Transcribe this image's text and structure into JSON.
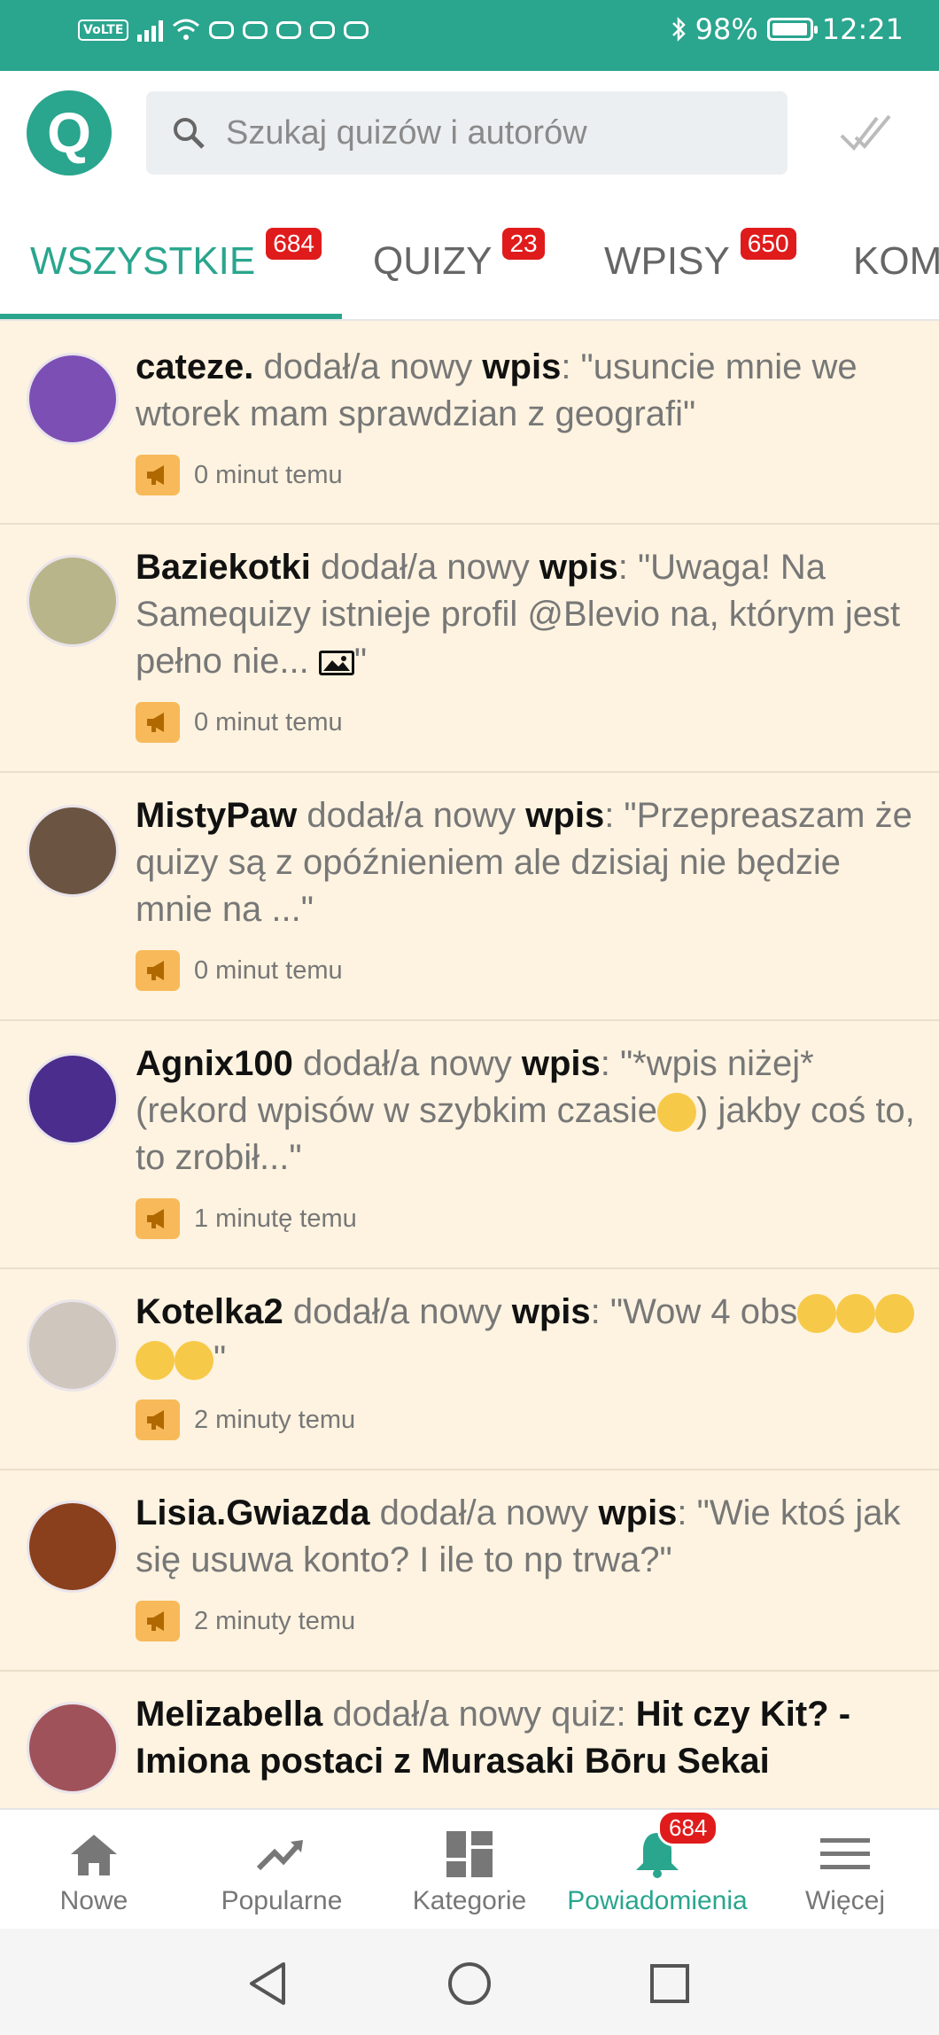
{
  "status_bar": {
    "volte": "VoLTE",
    "battery_pct": "98%",
    "battery_level": 0.98,
    "time": "12:21"
  },
  "header": {
    "logo_letter": "Q",
    "search_placeholder": "Szukaj quizów i autorów"
  },
  "tabs": [
    {
      "label": "WSZYSTKIE",
      "badge": "684",
      "active": true
    },
    {
      "label": "QUIZY",
      "badge": "23"
    },
    {
      "label": "WPISY",
      "badge": "650"
    },
    {
      "label": "KOM"
    }
  ],
  "feed": [
    {
      "user": "cateze.",
      "action": "dodał/a nowy",
      "type": "wpis",
      "text": "\"usuncie mnie we wtorek mam sprawdzian z geografi\"",
      "time": "0 minut temu",
      "avatar": "#7c4fb5"
    },
    {
      "user": "Baziekotki",
      "action": "dodał/a nowy",
      "type": "wpis",
      "text_before": "\"Uwaga! Na Samequizy istnieje profil @Blevio na, którym jest pełno nie...",
      "text_after": "\"",
      "time": "0 minut temu",
      "avatar": "#b9b58a"
    },
    {
      "user": "MistyPaw",
      "action": "dodał/a nowy",
      "type": "wpis",
      "text": "\"Przepreaszam że quizy są z opóźnieniem ale dzisiaj nie będzie mnie na ...\"",
      "time": "0 minut temu",
      "avatar": "#6b5442"
    },
    {
      "user": "Agnix100",
      "action": "dodał/a nowy",
      "type": "wpis",
      "text_before": "\"*wpis niżej* (rekord wpisów w szybkim czasie",
      "text_after": ") jakby coś to, to zrobił...\"",
      "time": "1 minutę temu",
      "avatar": "#4a2d8c"
    },
    {
      "user": "Kotelka2",
      "action": "dodał/a nowy",
      "type": "wpis",
      "text_before": "\"Wow 4 obs",
      "text_after": "\"",
      "time": "2 minuty temu",
      "avatar": "#cfc7bd"
    },
    {
      "user": "Lisia.Gwiazda",
      "action": "dodał/a nowy",
      "type": "wpis",
      "text": "\"Wie ktoś jak się usuwa konto? I ile to np trwa?\"",
      "time": "2 minuty temu",
      "avatar": "#8a3f1d"
    },
    {
      "user": "Melizabella",
      "action": "dodał/a nowy quiz:",
      "quiz_title": "Hit czy Kit? - Imiona postaci z Murasaki Bōru Sekai",
      "avatar": "#a0525a"
    }
  ],
  "bottom_nav": [
    {
      "label": "Nowe",
      "icon": "home-icon"
    },
    {
      "label": "Popularne",
      "icon": "trending-icon"
    },
    {
      "label": "Kategorie",
      "icon": "categories-icon"
    },
    {
      "label": "Powiadomienia",
      "icon": "bell-icon",
      "active": true,
      "badge": "684"
    },
    {
      "label": "Więcej",
      "icon": "menu-icon"
    }
  ],
  "colors": {
    "accent": "#2aa58e",
    "badge": "#e01b1b",
    "feed_bg": "#fdf3e0"
  }
}
